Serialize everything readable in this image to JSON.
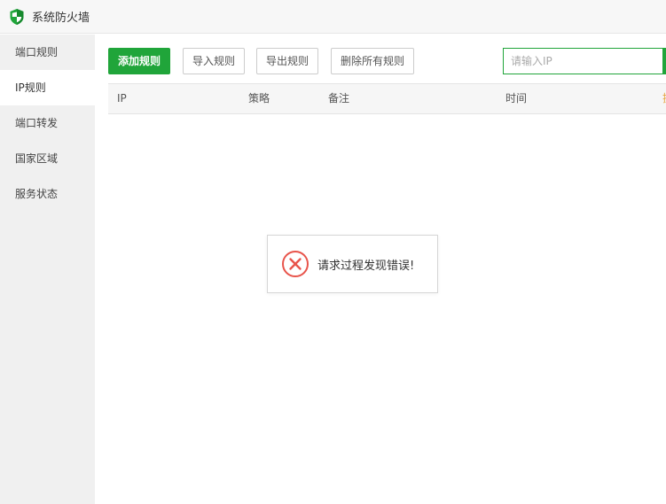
{
  "window": {
    "title": "系统防火墙"
  },
  "sidebar": {
    "items": [
      {
        "label": "端口规则"
      },
      {
        "label": "IP规则"
      },
      {
        "label": "端口转发"
      },
      {
        "label": "国家区域"
      },
      {
        "label": "服务状态"
      }
    ],
    "active_index": 1
  },
  "toolbar": {
    "add_label": "添加规则",
    "import_label": "导入规则",
    "export_label": "导出规则",
    "delete_all_label": "删除所有规则"
  },
  "search": {
    "placeholder": "请输入IP",
    "value": ""
  },
  "table": {
    "columns": [
      "IP",
      "策略",
      "备注",
      "时间",
      "操"
    ]
  },
  "toast": {
    "message": "请求过程发现错误!"
  },
  "colors": {
    "accent": "#20a53a",
    "error": "#e8544b"
  },
  "icons": {
    "logo": "shield-icon",
    "error": "error-circle-icon"
  }
}
